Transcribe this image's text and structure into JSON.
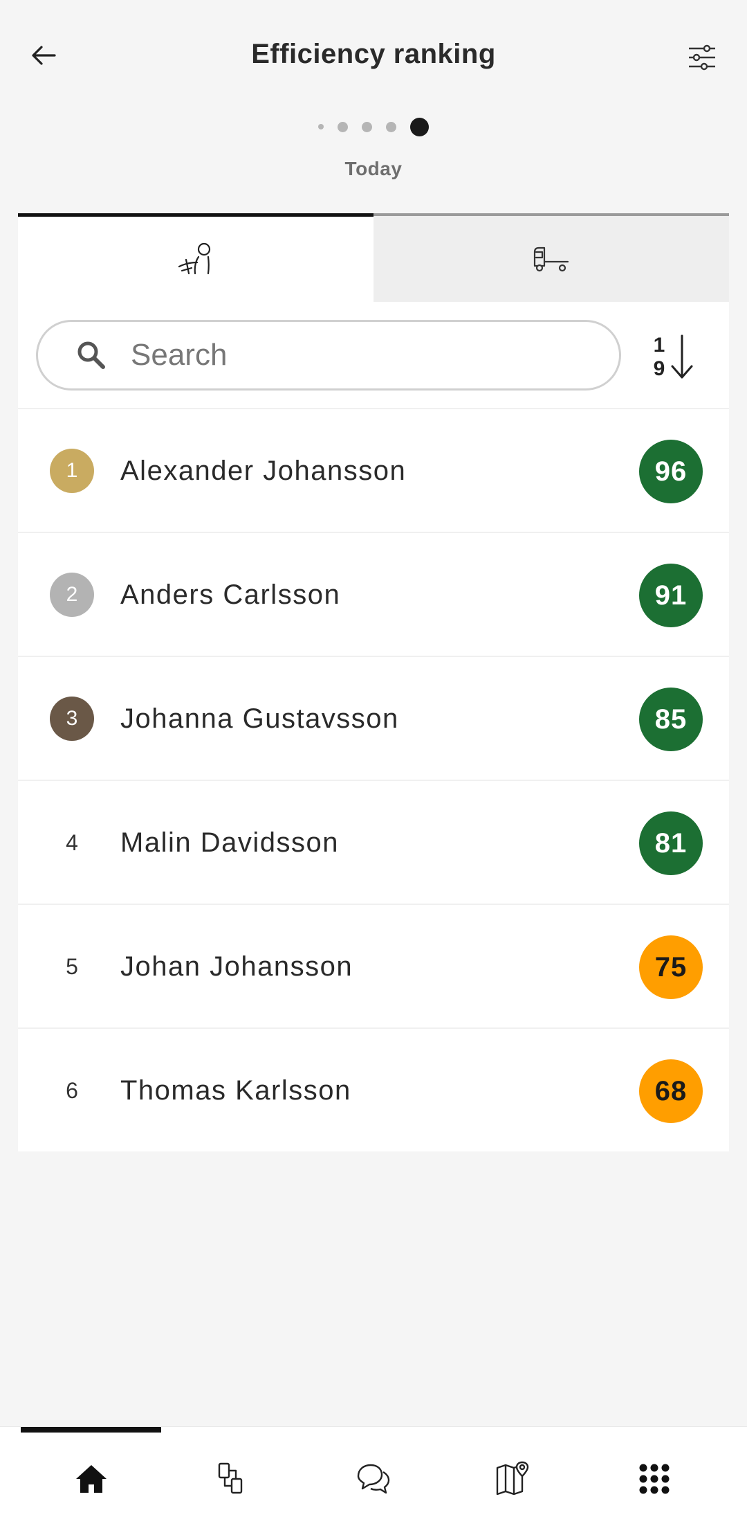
{
  "header": {
    "title": "Efficiency ranking",
    "back_icon": "arrow-left-icon",
    "filter_icon": "sliders-icon"
  },
  "pager": {
    "period": "Today",
    "page_count": 5,
    "active_index": 4
  },
  "tabs": [
    {
      "icon": "driver-icon",
      "active": true
    },
    {
      "icon": "truck-icon",
      "active": false
    }
  ],
  "search": {
    "placeholder": "Search",
    "value": ""
  },
  "sort": {
    "top": "1",
    "bottom": "9"
  },
  "ranking": [
    {
      "rank": "1",
      "name": "Alexander Johansson",
      "score": "96",
      "medal": "#c9ab61",
      "score_color": "#1c6f33"
    },
    {
      "rank": "2",
      "name": "Anders Carlsson",
      "score": "91",
      "medal": "#b3b3b3",
      "score_color": "#1c6f33"
    },
    {
      "rank": "3",
      "name": "Johanna Gustavsson",
      "score": "85",
      "medal": "#6a5847",
      "score_color": "#1c6f33"
    },
    {
      "rank": "4",
      "name": "Malin Davidsson",
      "score": "81",
      "medal": "",
      "score_color": "#1c6f33"
    },
    {
      "rank": "5",
      "name": "Johan Johansson",
      "score": "75",
      "medal": "",
      "score_color": "#ff9e00"
    },
    {
      "rank": "6",
      "name": "Thomas Karlsson",
      "score": "68",
      "medal": "",
      "score_color": "#ff9e00"
    }
  ],
  "bottom_nav": [
    {
      "icon": "home-icon",
      "active": true
    },
    {
      "icon": "documents-icon",
      "active": false
    },
    {
      "icon": "chat-icon",
      "active": false
    },
    {
      "icon": "map-icon",
      "active": false
    },
    {
      "icon": "apps-grid-icon",
      "active": false
    }
  ]
}
